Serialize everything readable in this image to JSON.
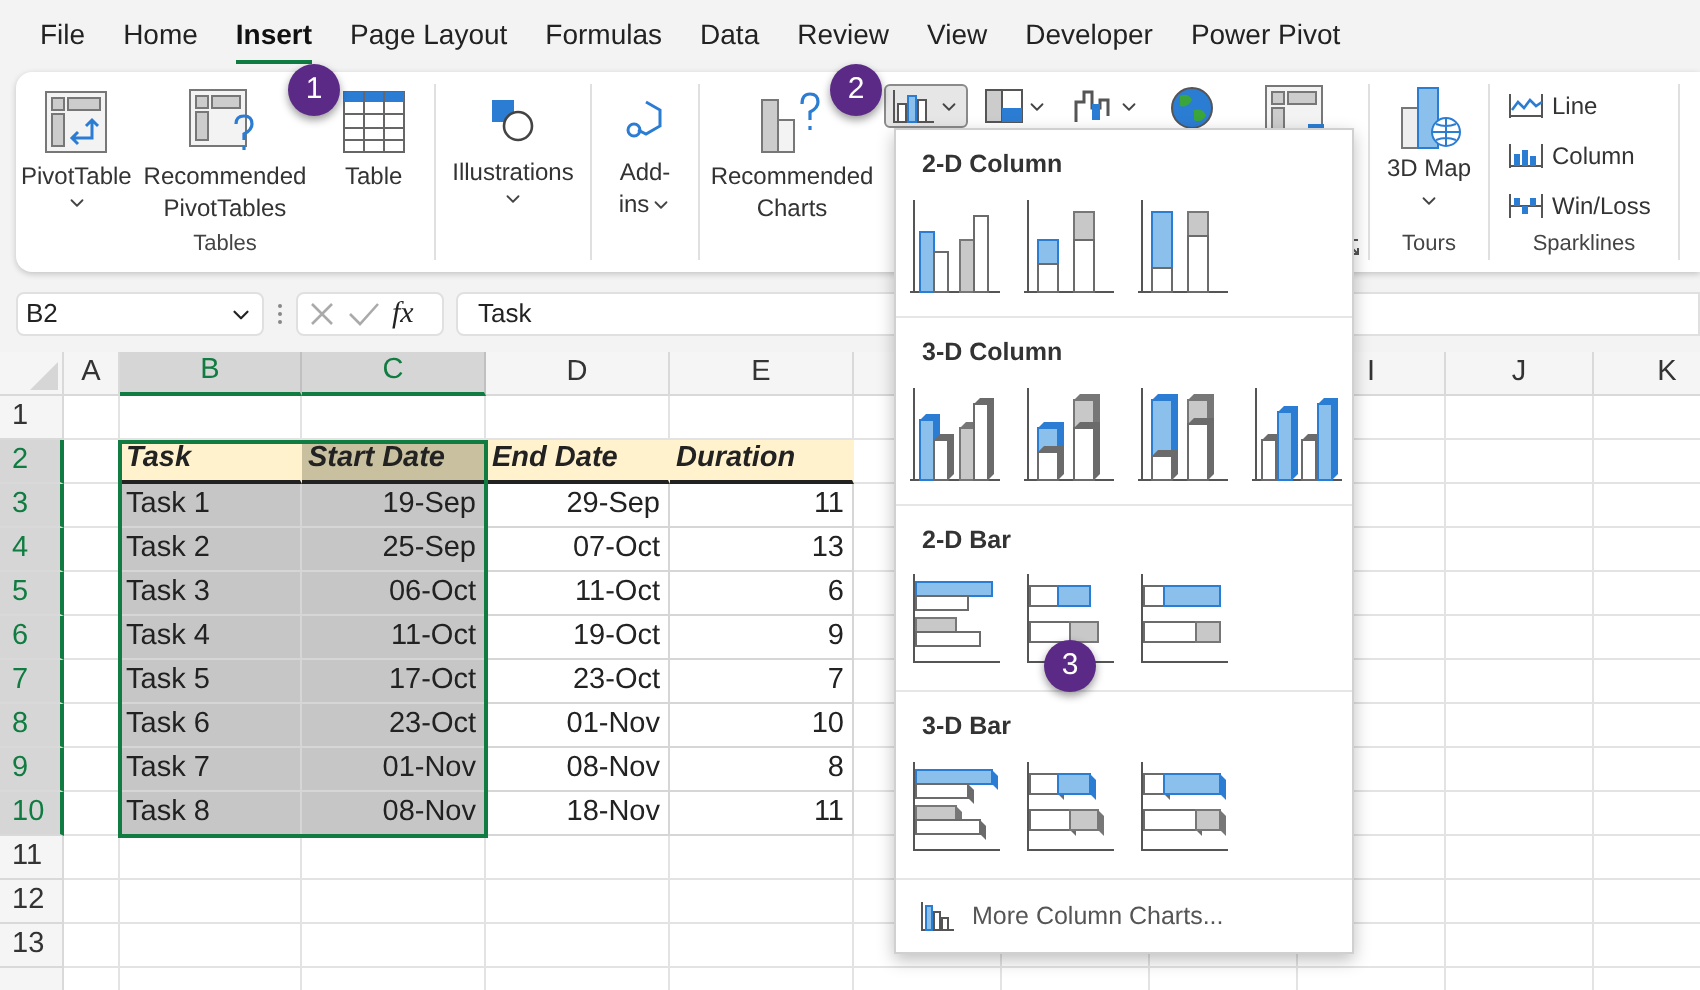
{
  "menu_tabs": [
    {
      "label": "File",
      "selected": false
    },
    {
      "label": "Home",
      "selected": false
    },
    {
      "label": "Insert",
      "selected": true
    },
    {
      "label": "Page Layout",
      "selected": false
    },
    {
      "label": "Formulas",
      "selected": false
    },
    {
      "label": "Data",
      "selected": false
    },
    {
      "label": "Review",
      "selected": false
    },
    {
      "label": "View",
      "selected": false
    },
    {
      "label": "Developer",
      "selected": false
    },
    {
      "label": "Power Pivot",
      "selected": false
    }
  ],
  "ribbon": {
    "tables": {
      "label": "Tables",
      "buttons": [
        {
          "label": "PivotTable",
          "kind": "pivot",
          "has_dropdown": true
        },
        {
          "label": "Recommended PivotTables",
          "kind": "recommended-pivot",
          "has_dropdown": false
        },
        {
          "label": "Table",
          "kind": "table",
          "has_dropdown": false
        }
      ]
    },
    "illustrations": {
      "label": "Illustrations",
      "has_dropdown": true
    },
    "addins": {
      "label": "Add-ins",
      "has_dropdown": true
    },
    "charts": {
      "recommended": {
        "label": "Recommended Charts"
      },
      "small_buttons": [
        {
          "kind": "column",
          "pressed": true
        },
        {
          "kind": "hierarchy",
          "pressed": false
        },
        {
          "kind": "waterfall",
          "pressed": false
        }
      ]
    },
    "tours": {
      "label": "Tours",
      "button": {
        "label": "3D Map",
        "has_dropdown": true
      }
    },
    "sparklines": {
      "label": "Sparklines",
      "items": [
        {
          "label": "Line",
          "kind": "line"
        },
        {
          "label": "Column",
          "kind": "column"
        },
        {
          "label": "Win/Loss",
          "kind": "winloss"
        }
      ]
    }
  },
  "formula_bar": {
    "name_box": "B2",
    "function_button": "fx",
    "value": "Task"
  },
  "sheet": {
    "columns": [
      {
        "label": "A",
        "selected": false
      },
      {
        "label": "B",
        "selected": true
      },
      {
        "label": "C",
        "selected": true
      },
      {
        "label": "D",
        "selected": false
      },
      {
        "label": "E",
        "selected": false
      },
      {
        "label": "I",
        "selected": false
      },
      {
        "label": "J",
        "selected": false
      },
      {
        "label": "K",
        "selected": false
      }
    ],
    "rows": [
      {
        "label": "1",
        "selected": false
      },
      {
        "label": "2",
        "selected": true,
        "cells": [
          {
            "text": "Task",
            "kind": "header",
            "selected": false
          },
          {
            "text": "Start Date",
            "kind": "header",
            "selected": true
          },
          {
            "text": "End Date",
            "kind": "header",
            "selected": false
          },
          {
            "text": "Duration",
            "kind": "header",
            "selected": false
          }
        ]
      },
      {
        "label": "3",
        "selected": true,
        "cells": [
          {
            "text": "Task 1",
            "kind": "text",
            "selected": true
          },
          {
            "text": "19-Sep",
            "kind": "number",
            "selected": true
          },
          {
            "text": "29-Sep",
            "kind": "number",
            "selected": false
          },
          {
            "text": "11",
            "kind": "number",
            "selected": false
          }
        ]
      },
      {
        "label": "4",
        "selected": true,
        "cells": [
          {
            "text": "Task 2",
            "kind": "text",
            "selected": true
          },
          {
            "text": "25-Sep",
            "kind": "number",
            "selected": true
          },
          {
            "text": "07-Oct",
            "kind": "number",
            "selected": false
          },
          {
            "text": "13",
            "kind": "number",
            "selected": false
          }
        ]
      },
      {
        "label": "5",
        "selected": true,
        "cells": [
          {
            "text": "Task 3",
            "kind": "text",
            "selected": true
          },
          {
            "text": "06-Oct",
            "kind": "number",
            "selected": true
          },
          {
            "text": "11-Oct",
            "kind": "number",
            "selected": false
          },
          {
            "text": "6",
            "kind": "number",
            "selected": false
          }
        ]
      },
      {
        "label": "6",
        "selected": true,
        "cells": [
          {
            "text": "Task 4",
            "kind": "text",
            "selected": true
          },
          {
            "text": "11-Oct",
            "kind": "number",
            "selected": true
          },
          {
            "text": "19-Oct",
            "kind": "number",
            "selected": false
          },
          {
            "text": "9",
            "kind": "number",
            "selected": false
          }
        ]
      },
      {
        "label": "7",
        "selected": true,
        "cells": [
          {
            "text": "Task 5",
            "kind": "text",
            "selected": true
          },
          {
            "text": "17-Oct",
            "kind": "number",
            "selected": true
          },
          {
            "text": "23-Oct",
            "kind": "number",
            "selected": false
          },
          {
            "text": "7",
            "kind": "number",
            "selected": false
          }
        ]
      },
      {
        "label": "8",
        "selected": true,
        "cells": [
          {
            "text": "Task 6",
            "kind": "text",
            "selected": true
          },
          {
            "text": "23-Oct",
            "kind": "number",
            "selected": true
          },
          {
            "text": "01-Nov",
            "kind": "number",
            "selected": false
          },
          {
            "text": "10",
            "kind": "number",
            "selected": false
          }
        ]
      },
      {
        "label": "9",
        "selected": true,
        "cells": [
          {
            "text": "Task 7",
            "kind": "text",
            "selected": true
          },
          {
            "text": "01-Nov",
            "kind": "number",
            "selected": true
          },
          {
            "text": "08-Nov",
            "kind": "number",
            "selected": false
          },
          {
            "text": "8",
            "kind": "number",
            "selected": false
          }
        ]
      },
      {
        "label": "10",
        "selected": true,
        "cells": [
          {
            "text": "Task 8",
            "kind": "text",
            "selected": true
          },
          {
            "text": "08-Nov",
            "kind": "number",
            "selected": true
          },
          {
            "text": "18-Nov",
            "kind": "number",
            "selected": false
          },
          {
            "text": "11",
            "kind": "number",
            "selected": false
          }
        ]
      },
      {
        "label": "11",
        "selected": false
      },
      {
        "label": "12",
        "selected": false
      },
      {
        "label": "13",
        "selected": false
      }
    ]
  },
  "chart_menu": {
    "sections": [
      {
        "title": "2-D Column",
        "kind": "column-2d"
      },
      {
        "title": "3-D Column",
        "kind": "column-3d"
      },
      {
        "title": "2-D Bar",
        "kind": "bar-2d"
      },
      {
        "title": "3-D Bar",
        "kind": "bar-3d"
      }
    ],
    "footer": "More Column Charts..."
  },
  "callouts": [
    "1",
    "2",
    "3"
  ]
}
